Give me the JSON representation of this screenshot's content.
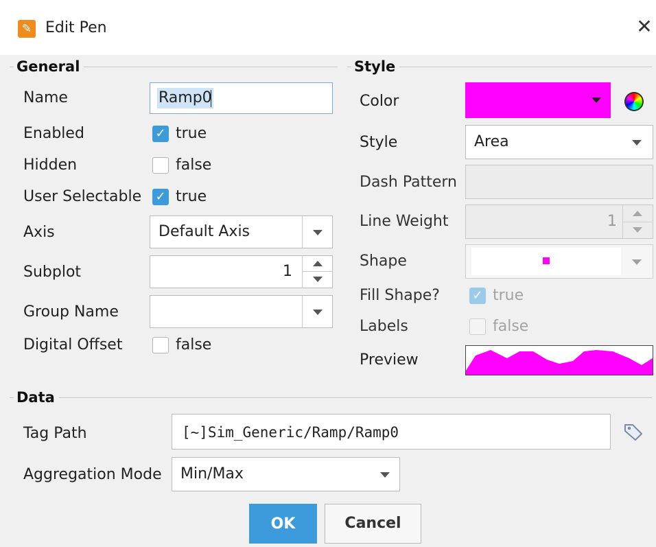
{
  "window": {
    "title": "Edit Pen",
    "app_icon": "brush-icon",
    "close_glyph": "✕"
  },
  "general": {
    "title": "General",
    "name": {
      "label": "Name",
      "value": "Ramp0"
    },
    "enabled": {
      "label": "Enabled",
      "checked": true,
      "text": "true"
    },
    "hidden": {
      "label": "Hidden",
      "checked": false,
      "text": "false"
    },
    "user_selectable": {
      "label": "User Selectable",
      "checked": true,
      "text": "true"
    },
    "axis": {
      "label": "Axis",
      "value": "Default Axis"
    },
    "subplot": {
      "label": "Subplot",
      "value": "1"
    },
    "group_name": {
      "label": "Group Name",
      "value": ""
    },
    "digital_offset": {
      "label": "Digital Offset",
      "checked": false,
      "text": "false"
    }
  },
  "style": {
    "title": "Style",
    "color": {
      "label": "Color",
      "value": "#ff00ff"
    },
    "style": {
      "label": "Style",
      "value": "Area"
    },
    "dash_pattern": {
      "label": "Dash Pattern",
      "value": ""
    },
    "line_weight": {
      "label": "Line Weight",
      "value": "1"
    },
    "shape": {
      "label": "Shape",
      "marker_color": "#ff00ff"
    },
    "fill_shape": {
      "label": "Fill Shape?",
      "checked": true,
      "text": "true"
    },
    "labels": {
      "label": "Labels",
      "checked": false,
      "text": "false"
    },
    "preview": {
      "label": "Preview",
      "color": "#ff00ff"
    }
  },
  "data": {
    "title": "Data",
    "tag_path": {
      "label": "Tag Path",
      "value": "[~]Sim_Generic/Ramp/Ramp0"
    },
    "aggregation_mode": {
      "label": "Aggregation Mode",
      "value": "Min/Max"
    }
  },
  "buttons": {
    "ok": "OK",
    "cancel": "Cancel"
  }
}
